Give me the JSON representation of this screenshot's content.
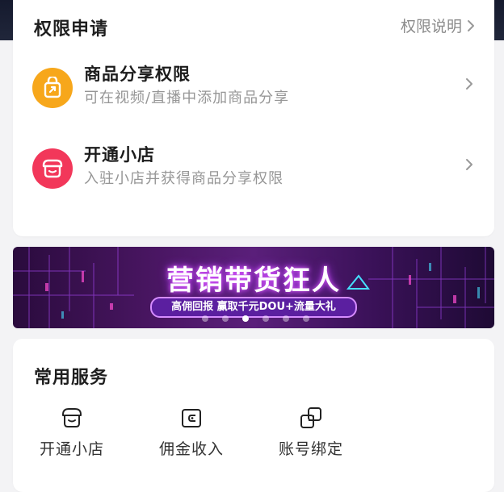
{
  "permissions": {
    "title": "权限申请",
    "link_label": "权限说明",
    "items": [
      {
        "title": "商品分享权限",
        "subtitle": "可在视频/直播中添加商品分享",
        "icon": "share-bag-icon",
        "color": "#f7a71b"
      },
      {
        "title": "开通小店",
        "subtitle": "入驻小店并获得商品分享权限",
        "icon": "store-icon",
        "color": "#f2375a"
      }
    ]
  },
  "banner": {
    "title": "营销带货狂人",
    "subtitle": "高佣回报 赢取千元DOU+流量大礼",
    "dot_count": 6,
    "active_dot": 3
  },
  "services": {
    "title": "常用服务",
    "items": [
      {
        "label": "开通小店",
        "icon": "store-icon"
      },
      {
        "label": "佣金收入",
        "icon": "wallet-icon"
      },
      {
        "label": "账号绑定",
        "icon": "link-accounts-icon"
      }
    ]
  }
}
